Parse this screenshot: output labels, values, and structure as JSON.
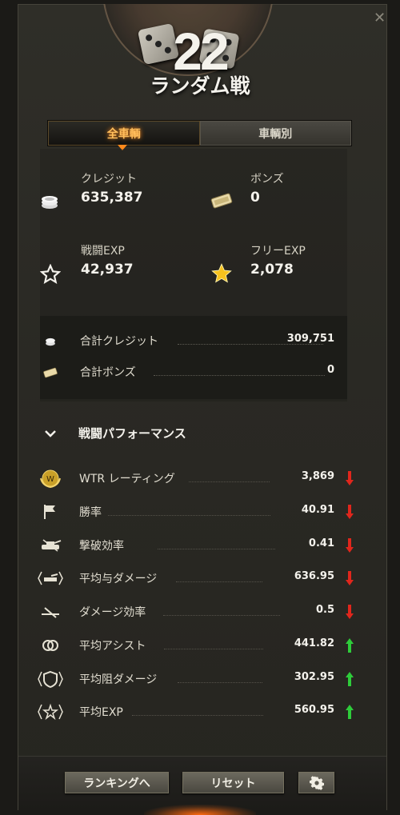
{
  "header": {
    "battle_count": "22",
    "mode_title": "ランダム戦",
    "close_glyph": "✕"
  },
  "tabs": [
    {
      "label": "全車輌",
      "active": true
    },
    {
      "label": "車輌別",
      "active": false
    }
  ],
  "summary": {
    "credits": {
      "label": "クレジット",
      "value": "635,387",
      "icon": "credits-icon"
    },
    "bonds": {
      "label": "ボンズ",
      "value": "0",
      "icon": "bonds-icon"
    },
    "battle_exp": {
      "label": "戦闘EXP",
      "value": "42,937",
      "icon": "star-outline-icon"
    },
    "free_exp": {
      "label": "フリーEXP",
      "value": "2,078",
      "icon": "gold-star-icon"
    }
  },
  "totals": [
    {
      "label": "合計クレジット",
      "value": "309,751",
      "icon": "credits-icon"
    },
    {
      "label": "合計ボンズ",
      "value": "0",
      "icon": "bonds-icon"
    }
  ],
  "performance": {
    "title": "戦闘パフォーマンス",
    "rows": [
      {
        "label": "WTR レーティング",
        "value": "3,869",
        "trend": "down",
        "icon": "wtr-rating-icon"
      },
      {
        "label": "勝率",
        "value": "40.91",
        "trend": "down",
        "icon": "flag-icon"
      },
      {
        "label": "撃破効率",
        "value": "0.41",
        "trend": "down",
        "icon": "destroyed-tank-icon"
      },
      {
        "label": "平均与ダメージ",
        "value": "636.95",
        "trend": "down",
        "icon": "damage-dealt-icon"
      },
      {
        "label": "ダメージ効率",
        "value": "0.5",
        "trend": "down",
        "icon": "damage-ratio-icon"
      },
      {
        "label": "平均アシスト",
        "value": "441.82",
        "trend": "up",
        "icon": "assist-icon"
      },
      {
        "label": "平均阻ダメージ",
        "value": "302.95",
        "trend": "up",
        "icon": "blocked-damage-icon"
      },
      {
        "label": "平均EXP",
        "value": "560.95",
        "trend": "up",
        "icon": "average-exp-icon"
      }
    ]
  },
  "footer": {
    "ranking_label": "ランキングへ",
    "reset_label": "リセット",
    "settings_icon": "gear-icon"
  },
  "colors": {
    "accent": "#ff8a1c",
    "up": "#2ecc3a",
    "down": "#e0261c"
  }
}
